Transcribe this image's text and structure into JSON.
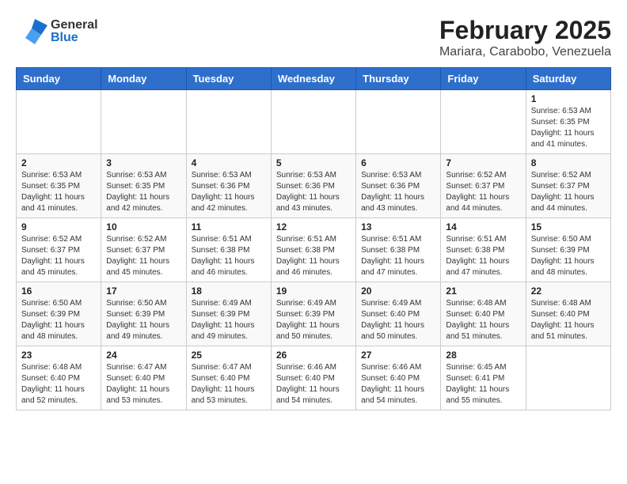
{
  "header": {
    "logo": {
      "general": "General",
      "blue": "Blue"
    },
    "title": "February 2025",
    "location": "Mariara, Carabobo, Venezuela"
  },
  "days_of_week": [
    "Sunday",
    "Monday",
    "Tuesday",
    "Wednesday",
    "Thursday",
    "Friday",
    "Saturday"
  ],
  "weeks": [
    [
      {
        "day": "",
        "info": ""
      },
      {
        "day": "",
        "info": ""
      },
      {
        "day": "",
        "info": ""
      },
      {
        "day": "",
        "info": ""
      },
      {
        "day": "",
        "info": ""
      },
      {
        "day": "",
        "info": ""
      },
      {
        "day": "1",
        "info": "Sunrise: 6:53 AM\nSunset: 6:35 PM\nDaylight: 11 hours and 41 minutes."
      }
    ],
    [
      {
        "day": "2",
        "info": "Sunrise: 6:53 AM\nSunset: 6:35 PM\nDaylight: 11 hours and 41 minutes."
      },
      {
        "day": "3",
        "info": "Sunrise: 6:53 AM\nSunset: 6:35 PM\nDaylight: 11 hours and 42 minutes."
      },
      {
        "day": "4",
        "info": "Sunrise: 6:53 AM\nSunset: 6:36 PM\nDaylight: 11 hours and 42 minutes."
      },
      {
        "day": "5",
        "info": "Sunrise: 6:53 AM\nSunset: 6:36 PM\nDaylight: 11 hours and 43 minutes."
      },
      {
        "day": "6",
        "info": "Sunrise: 6:53 AM\nSunset: 6:36 PM\nDaylight: 11 hours and 43 minutes."
      },
      {
        "day": "7",
        "info": "Sunrise: 6:52 AM\nSunset: 6:37 PM\nDaylight: 11 hours and 44 minutes."
      },
      {
        "day": "8",
        "info": "Sunrise: 6:52 AM\nSunset: 6:37 PM\nDaylight: 11 hours and 44 minutes."
      }
    ],
    [
      {
        "day": "9",
        "info": "Sunrise: 6:52 AM\nSunset: 6:37 PM\nDaylight: 11 hours and 45 minutes."
      },
      {
        "day": "10",
        "info": "Sunrise: 6:52 AM\nSunset: 6:37 PM\nDaylight: 11 hours and 45 minutes."
      },
      {
        "day": "11",
        "info": "Sunrise: 6:51 AM\nSunset: 6:38 PM\nDaylight: 11 hours and 46 minutes."
      },
      {
        "day": "12",
        "info": "Sunrise: 6:51 AM\nSunset: 6:38 PM\nDaylight: 11 hours and 46 minutes."
      },
      {
        "day": "13",
        "info": "Sunrise: 6:51 AM\nSunset: 6:38 PM\nDaylight: 11 hours and 47 minutes."
      },
      {
        "day": "14",
        "info": "Sunrise: 6:51 AM\nSunset: 6:38 PM\nDaylight: 11 hours and 47 minutes."
      },
      {
        "day": "15",
        "info": "Sunrise: 6:50 AM\nSunset: 6:39 PM\nDaylight: 11 hours and 48 minutes."
      }
    ],
    [
      {
        "day": "16",
        "info": "Sunrise: 6:50 AM\nSunset: 6:39 PM\nDaylight: 11 hours and 48 minutes."
      },
      {
        "day": "17",
        "info": "Sunrise: 6:50 AM\nSunset: 6:39 PM\nDaylight: 11 hours and 49 minutes."
      },
      {
        "day": "18",
        "info": "Sunrise: 6:49 AM\nSunset: 6:39 PM\nDaylight: 11 hours and 49 minutes."
      },
      {
        "day": "19",
        "info": "Sunrise: 6:49 AM\nSunset: 6:39 PM\nDaylight: 11 hours and 50 minutes."
      },
      {
        "day": "20",
        "info": "Sunrise: 6:49 AM\nSunset: 6:40 PM\nDaylight: 11 hours and 50 minutes."
      },
      {
        "day": "21",
        "info": "Sunrise: 6:48 AM\nSunset: 6:40 PM\nDaylight: 11 hours and 51 minutes."
      },
      {
        "day": "22",
        "info": "Sunrise: 6:48 AM\nSunset: 6:40 PM\nDaylight: 11 hours and 51 minutes."
      }
    ],
    [
      {
        "day": "23",
        "info": "Sunrise: 6:48 AM\nSunset: 6:40 PM\nDaylight: 11 hours and 52 minutes."
      },
      {
        "day": "24",
        "info": "Sunrise: 6:47 AM\nSunset: 6:40 PM\nDaylight: 11 hours and 53 minutes."
      },
      {
        "day": "25",
        "info": "Sunrise: 6:47 AM\nSunset: 6:40 PM\nDaylight: 11 hours and 53 minutes."
      },
      {
        "day": "26",
        "info": "Sunrise: 6:46 AM\nSunset: 6:40 PM\nDaylight: 11 hours and 54 minutes."
      },
      {
        "day": "27",
        "info": "Sunrise: 6:46 AM\nSunset: 6:40 PM\nDaylight: 11 hours and 54 minutes."
      },
      {
        "day": "28",
        "info": "Sunrise: 6:45 AM\nSunset: 6:41 PM\nDaylight: 11 hours and 55 minutes."
      },
      {
        "day": "",
        "info": ""
      }
    ]
  ]
}
